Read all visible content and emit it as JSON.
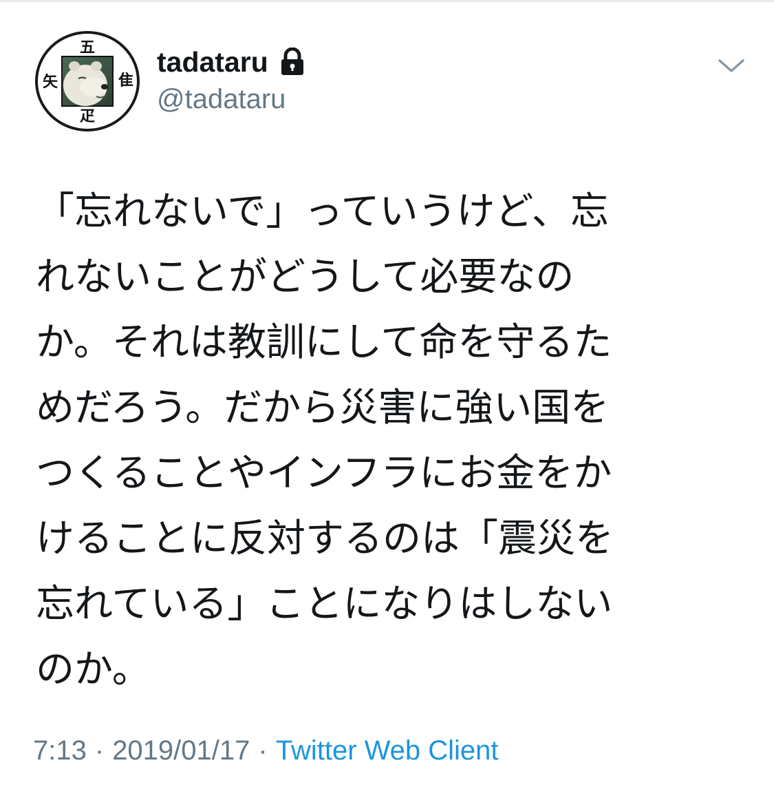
{
  "tweet": {
    "display_name": "tadataru",
    "handle": "@tadataru",
    "protected": true,
    "lines": [
      "「忘れないで」っていうけど、忘",
      "れないことがどうして必要なの",
      "か。それは教訓にして命を守るた",
      "めだろう。だから災害に強い国を",
      "つくることやインフラにお金をか",
      "けることに反対するのは「震災を",
      "忘れている」ことになりはしない",
      "のか。"
    ],
    "time": "7:13",
    "date": "2019/01/17",
    "separator": "·",
    "client": "Twitter Web Client"
  },
  "avatar": {
    "char_top": "五",
    "char_left": "矢",
    "char_right": "隹",
    "char_bottom": "疋"
  },
  "icons": {
    "lock": "lock-icon",
    "chevron": "chevron-down-icon"
  },
  "colors": {
    "text": "#14171a",
    "secondary": "#657786",
    "link": "#1b95e0",
    "divider": "#e6ecf0"
  }
}
